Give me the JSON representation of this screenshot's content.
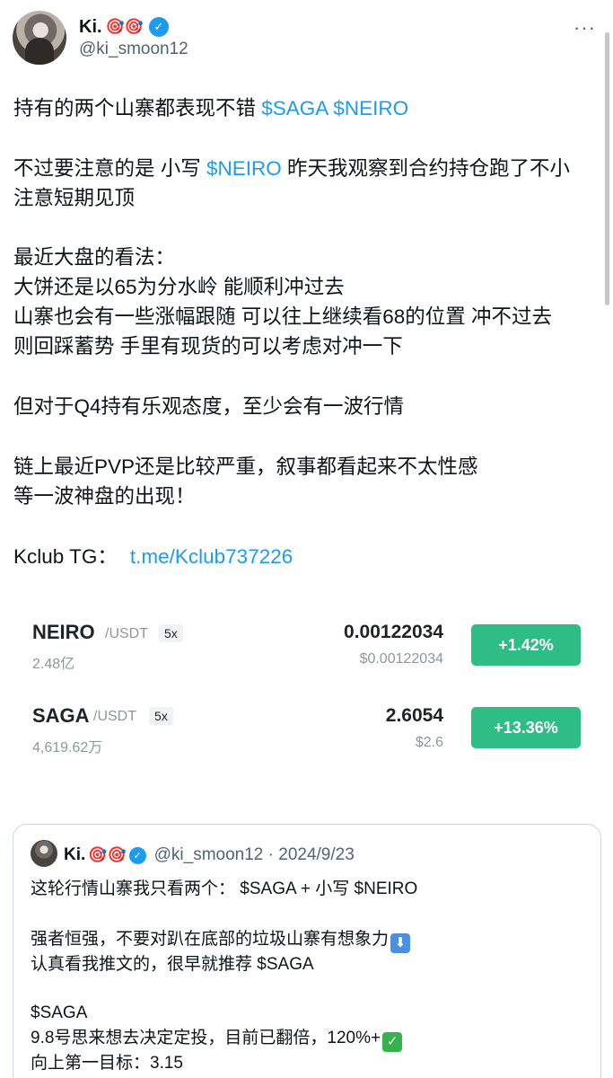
{
  "author": {
    "display_name": "Ki.",
    "name_emojis": "🎯🎯",
    "handle": "@ki_smoon12"
  },
  "tweet": {
    "line1_text": "持有的两个山寨都表现不错 ",
    "line1_tags": "$SAGA $NEIRO",
    "line2_pre": "不过要注意的是 小写 ",
    "line2_tag": "$NEIRO",
    "line2_post": " 昨天我观察到合约持仓跑了不小",
    "line3": "注意短期见顶",
    "line4": "最近大盘的看法：",
    "line5": "大饼还是以65为分水岭 能顺利冲过去",
    "line6": "山寨也会有一些涨幅跟随 可以往上继续看68的位置 冲不过去",
    "line7": "则回踩蓄势  手里有现货的可以考虑对冲一下",
    "line8": "但对于Q4持有乐观态度，至少会有一波行情",
    "line9": "链上最近PVP还是比较严重，叙事都看起来不太性感",
    "line10": "等一波神盘的出现！",
    "kclub_label": "Kclub TG：",
    "kclub_link": "t.me/Kclub737226"
  },
  "market": [
    {
      "symbol": "NEIRO",
      "quote": "/USDT",
      "leverage": "5x",
      "volume": "2.48亿",
      "price": "0.00122034",
      "usd_price": "$0.00122034",
      "change": "+1.42%"
    },
    {
      "symbol": "SAGA",
      "quote": "/USDT",
      "leverage": "5x",
      "volume": "4,619.62万",
      "price": "2.6054",
      "usd_price": "$2.6",
      "change": "+13.36%"
    }
  ],
  "colors": {
    "accent": "#1d9bf0",
    "positive": "#2ebd85"
  },
  "quoted_tweet": {
    "display_name": "Ki.",
    "name_emojis": "🎯🎯",
    "handle_date": "@ki_smoon12 · 2024/9/23",
    "line1": "这轮行情山寨我只看两个：  $SAGA + 小写 $NEIRO",
    "line2": "强者恒强，不要对趴在底部的垃圾山寨有想象力",
    "line3": "认真看我推文的，很早就推荐 $SAGA",
    "line4": "$SAGA",
    "line5": " 9.8号思来想去决定定投，目前已翻倍，120%+",
    "line6": "向上第一目标：3.15"
  }
}
